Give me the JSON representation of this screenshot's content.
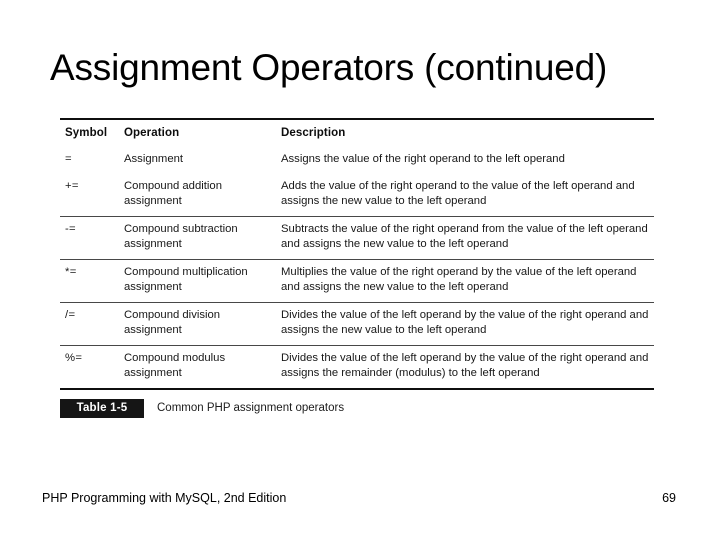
{
  "slide": {
    "title": "Assignment Operators (continued)"
  },
  "table": {
    "headers": {
      "symbol": "Symbol",
      "operation": "Operation",
      "description": "Description"
    },
    "rows": [
      {
        "symbol": "=",
        "operation": "Assignment",
        "description": "Assigns the value of the right operand to the left operand"
      },
      {
        "symbol": "+=",
        "operation": "Compound addition assignment",
        "description": "Adds the value of the right operand to the value of the left operand and assigns the new value to the left operand"
      },
      {
        "symbol": "-=",
        "operation": "Compound subtraction assignment",
        "description": "Subtracts the value of the right operand from the value of the left operand and assigns the new value to the left operand"
      },
      {
        "symbol": "*=",
        "operation": "Compound multiplication assignment",
        "description": "Multiplies the value of the right operand by the value of the left operand and assigns the new value to the left operand"
      },
      {
        "symbol": "/=",
        "operation": "Compound division assignment",
        "description": "Divides the value of the left operand by the value of the right operand and assigns the new value to the left operand"
      },
      {
        "symbol": "%=",
        "operation": "Compound modulus assignment",
        "description": "Divides the value of the left operand by the value of the right operand and assigns the remainder (modulus) to the left operand"
      }
    ]
  },
  "caption": {
    "badge": "Table 1-5",
    "text": "Common PHP assignment operators"
  },
  "footer": {
    "book": "PHP Programming with MySQL, 2nd Edition",
    "page": "69"
  },
  "colors": {
    "text": "#000000",
    "badge_bg": "#151515",
    "badge_text": "#ffffff",
    "rule_heavy": "#131313",
    "rule_light": "#4a4a4a",
    "background": "#ffffff"
  }
}
